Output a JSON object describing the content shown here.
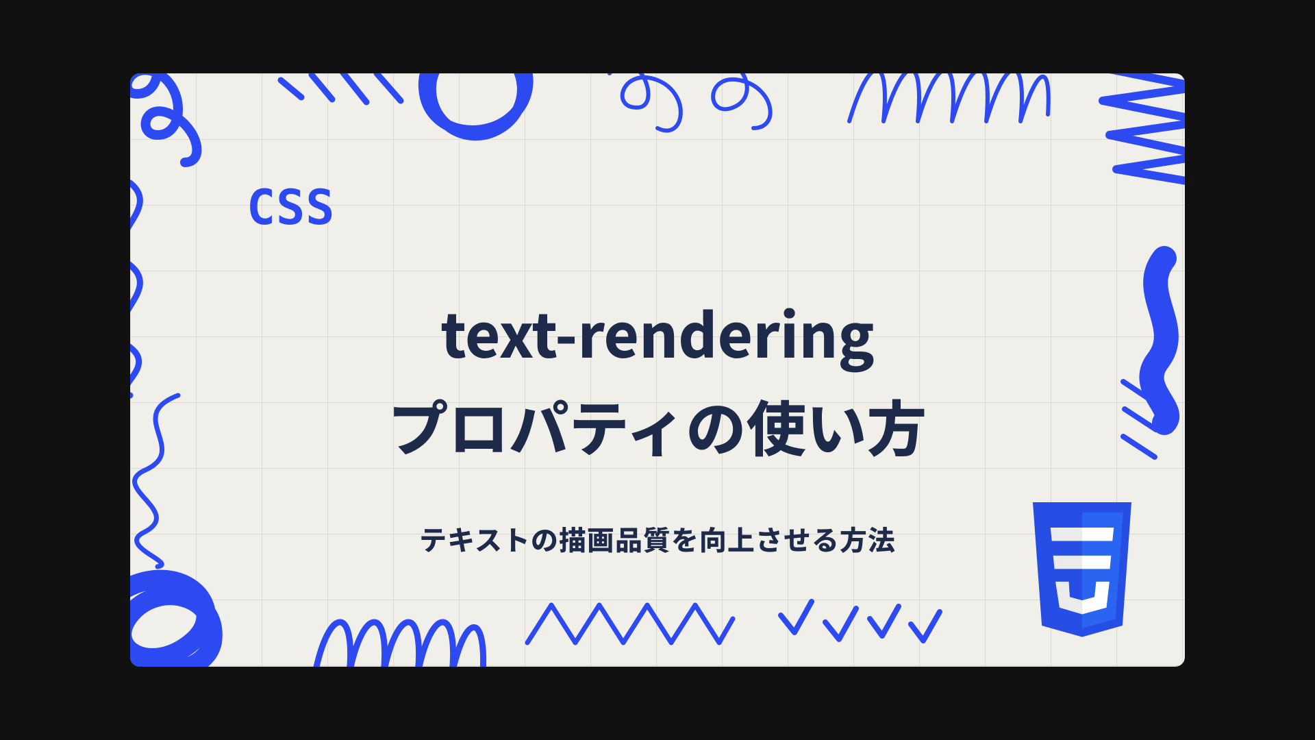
{
  "label": "CSS",
  "title_line1": "text-rendering",
  "title_line2": "プロパティの使い方",
  "subtitle": "テキストの描画品質を向上させる方法",
  "colors": {
    "accent": "#2d4af2",
    "heading": "#1e2a4a",
    "paper": "#f0efea"
  },
  "badge": {
    "name": "CSS3"
  }
}
